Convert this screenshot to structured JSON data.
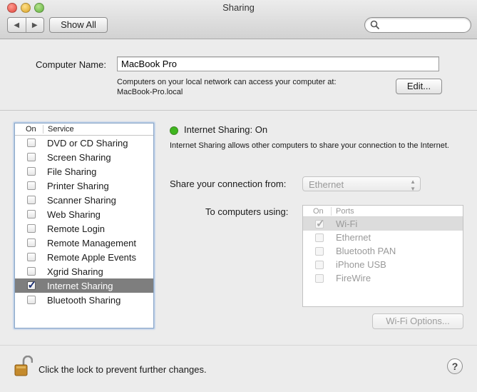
{
  "window": {
    "title": "Sharing"
  },
  "toolbar": {
    "back_icon": "back-arrow-icon",
    "forward_icon": "forward-arrow-icon",
    "show_all_label": "Show All",
    "search_icon": "search-icon"
  },
  "computer_name": {
    "label": "Computer Name:",
    "value": "MacBook Pro",
    "info_line1": "Computers on your local network can access your computer at:",
    "info_line2": "MacBook-Pro.local",
    "edit_label": "Edit..."
  },
  "services": {
    "header_on": "On",
    "header_service": "Service",
    "items": [
      {
        "label": "DVD or CD Sharing",
        "checked": false,
        "selected": false
      },
      {
        "label": "Screen Sharing",
        "checked": false,
        "selected": false
      },
      {
        "label": "File Sharing",
        "checked": false,
        "selected": false
      },
      {
        "label": "Printer Sharing",
        "checked": false,
        "selected": false
      },
      {
        "label": "Scanner Sharing",
        "checked": false,
        "selected": false
      },
      {
        "label": "Web Sharing",
        "checked": false,
        "selected": false
      },
      {
        "label": "Remote Login",
        "checked": false,
        "selected": false
      },
      {
        "label": "Remote Management",
        "checked": false,
        "selected": false
      },
      {
        "label": "Remote Apple Events",
        "checked": false,
        "selected": false
      },
      {
        "label": "Xgrid Sharing",
        "checked": false,
        "selected": false
      },
      {
        "label": "Internet Sharing",
        "checked": true,
        "selected": true
      },
      {
        "label": "Bluetooth Sharing",
        "checked": false,
        "selected": false
      }
    ]
  },
  "detail": {
    "status_color": "#3fb61f",
    "status_text": "Internet Sharing: On",
    "description": "Internet Sharing allows other computers to share your connection to the Internet.",
    "share_from_label": "Share your connection from:",
    "share_from_value": "Ethernet",
    "to_computers_label": "To computers using:",
    "ports_header_on": "On",
    "ports_header_ports": "Ports",
    "ports": [
      {
        "label": "Wi-Fi",
        "checked": true,
        "selected": true
      },
      {
        "label": "Ethernet",
        "checked": false,
        "selected": false
      },
      {
        "label": "Bluetooth PAN",
        "checked": false,
        "selected": false
      },
      {
        "label": "iPhone USB",
        "checked": false,
        "selected": false
      },
      {
        "label": "FireWire",
        "checked": false,
        "selected": false
      }
    ],
    "wifi_options_label": "Wi-Fi Options..."
  },
  "footer": {
    "lock_icon": "lock-icon",
    "lock_text": "Click the lock to prevent further changes.",
    "help_label": "?"
  }
}
